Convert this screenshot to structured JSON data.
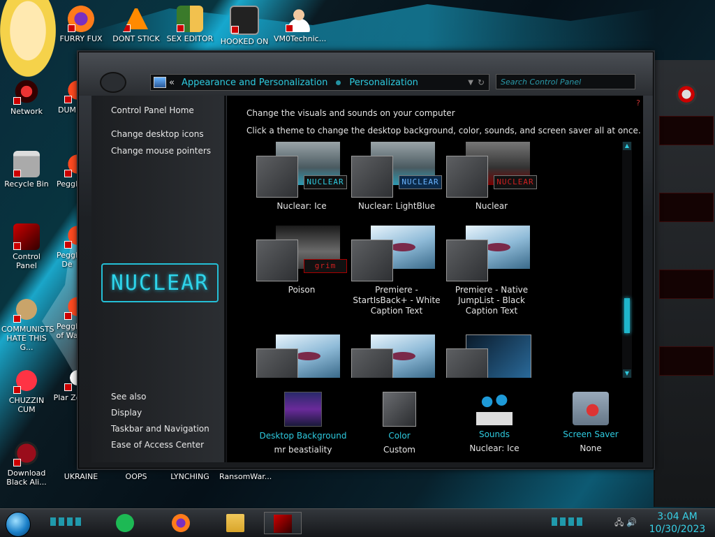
{
  "desktop": {
    "icons": [
      {
        "label": "FURRY FUX",
        "icon": "firefox-icon"
      },
      {
        "label": "DONT STICK",
        "icon": "vlc-icon"
      },
      {
        "label": "SEX EDITOR",
        "icon": "hxd-icon"
      },
      {
        "label": "HOOKED ON",
        "icon": "hooked-on-icon"
      },
      {
        "label": "VM0Technic...",
        "icon": "doctor-icon"
      },
      {
        "label": "Network",
        "icon": "network-icon"
      },
      {
        "label": "Recycle Bin",
        "icon": "recycle-bin-icon"
      },
      {
        "label": "Control Panel",
        "icon": "control-panel-icon"
      },
      {
        "label": "COMMUNISTS HATE THIS G...",
        "icon": "money-bag-icon"
      },
      {
        "label": "CHUZZIN CUM",
        "icon": "chuzzle-icon"
      },
      {
        "label": "Download Black Ali...",
        "icon": "black-alien-icon"
      },
      {
        "label": "UKRAINE",
        "icon": "peggle-icon"
      },
      {
        "label": "OOPS",
        "icon": ""
      },
      {
        "label": "LYNCHING",
        "icon": ""
      },
      {
        "label": "RansomWar...",
        "icon": ""
      }
    ],
    "partial_labels": [
      "C",
      "D",
      "DUM",
      "Peggl",
      "Peggl De",
      "Peggl of Wa",
      "Plar Zo"
    ]
  },
  "window": {
    "breadcrumb": [
      "Appearance and Personalization",
      "Personalization"
    ],
    "back_glyph": "«",
    "search_placeholder": "Search Control Panel",
    "help_glyph": "?"
  },
  "sidebar": {
    "home": "Control Panel Home",
    "links": [
      "Change desktop icons",
      "Change mouse pointers"
    ],
    "logo_text": "NUCLEAR",
    "see_also_title": "See also",
    "see_also": [
      "Display",
      "Taskbar and Navigation",
      "Ease of Access Center"
    ]
  },
  "content": {
    "title": "Change the visuals and sounds on your computer",
    "subtitle": "Click a theme to change the desktop background, color, sounds, and screen saver all at once.",
    "themes": [
      {
        "name": "Nuclear: Ice",
        "badge": "NUCLEAR",
        "badge_color": "#2ecbe0"
      },
      {
        "name": "Nuclear: LightBlue",
        "badge": "NUCLEAR",
        "badge_color": "#6ab4ff"
      },
      {
        "name": "Nuclear",
        "badge": "NUCLEAR",
        "badge_color": "#d02020"
      },
      {
        "name": "Poison",
        "badge": "grim",
        "badge_color": "#d02020"
      },
      {
        "name": "Premiere - StartIsBack+ - White Caption Text",
        "badge": "",
        "badge_color": ""
      },
      {
        "name": "Premiere - Native JumpList - Black Caption Text",
        "badge": "",
        "badge_color": ""
      },
      {
        "name": "",
        "badge": "",
        "badge_color": ""
      },
      {
        "name": "",
        "badge": "",
        "badge_color": ""
      },
      {
        "name": "",
        "badge": "",
        "badge_color": ""
      }
    ],
    "bottom": [
      {
        "label": "Desktop Background",
        "value": "mr beastiality",
        "icon": "desktop-background-icon"
      },
      {
        "label": "Color",
        "value": "Custom",
        "icon": "color-swatch-icon"
      },
      {
        "label": "Sounds",
        "value": "Nuclear: Ice",
        "icon": "sounds-icon"
      },
      {
        "label": "Screen Saver",
        "value": "None",
        "icon": "screen-saver-icon"
      }
    ]
  },
  "taskbar": {
    "time": "3:04 AM",
    "date": "10/30/2023"
  },
  "colors": {
    "accent": "#2ecbe0",
    "text": "#e6e6e6"
  }
}
